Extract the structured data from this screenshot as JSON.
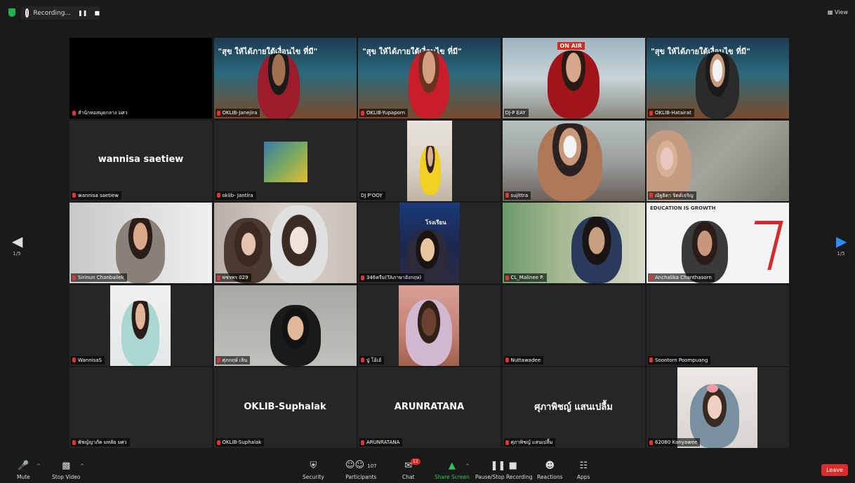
{
  "topbar": {
    "recording_label": "Recording...",
    "view_label": "View"
  },
  "pager": {
    "left": "1/5",
    "right": "1/5"
  },
  "tiles": [
    {
      "name": "สำนักหอสมุดกลาง มศว"
    },
    {
      "name": "OKLIB-Janejira"
    },
    {
      "name": "OKLIB-Yupaporn"
    },
    {
      "name": "DJ-P EAY"
    },
    {
      "name": "OKLIB-Hatairat"
    },
    {
      "name": "wannisa saetiew",
      "big": "wannisa saetiew"
    },
    {
      "name": "oklib- Jantira"
    },
    {
      "name": "DJ P'OOY"
    },
    {
      "name": "sujittra"
    },
    {
      "name": "ณัฐธิดา จิตต์เจริญ"
    },
    {
      "name": "Sirinun Chanbailek"
    },
    {
      "name": "พชรพร 029"
    },
    {
      "name": "346ครีม(TAภาษาอังกฤษ)"
    },
    {
      "name": "CL_Malinee P."
    },
    {
      "name": "Anchalika Chanthasorn"
    },
    {
      "name": "WannisaS"
    },
    {
      "name": "ศุภกฤษ์ เลิน"
    },
    {
      "name": "ปู่ โอ้เอ้"
    },
    {
      "name": "Nuttawadee"
    },
    {
      "name": "Soontorn Poompuang"
    },
    {
      "name": "พัชญ์ญาภัค มหลัย มศว"
    },
    {
      "name": "OKLIB-Suphalak",
      "big": "OKLIB-Suphalak"
    },
    {
      "name": "ARUNRATANA",
      "big": "ARUNRATANA"
    },
    {
      "name": "ศุภาพิชญ์ แสนเปลื้ม",
      "big": "ศุภาพิชญ์ แสนเปลื้ม"
    },
    {
      "name": "62080 Kanyawee"
    }
  ],
  "overlays": {
    "big_title": "\"สุข ให้ได้ภายใต้เงื่อนไข ที่มี\"",
    "on_air": "ON AIR",
    "education": "EDUCATION IS GROWTH",
    "school_sign": "โรงเรียน"
  },
  "controls": {
    "mute": "Mute",
    "stop_video": "Stop Video",
    "security": "Security",
    "participants": "Participants",
    "participants_count": "107",
    "chat": "Chat",
    "chat_badge": "12",
    "share_screen": "Share Screen",
    "pause_recording": "Pause/Stop Recording",
    "reactions": "Reactions",
    "apps": "Apps",
    "leave": "Leave"
  },
  "colors": {
    "leave": "#d92c2c",
    "share": "#2fc35a",
    "active_speaker": "#e8e26a",
    "muted_mic": "#e03535"
  }
}
